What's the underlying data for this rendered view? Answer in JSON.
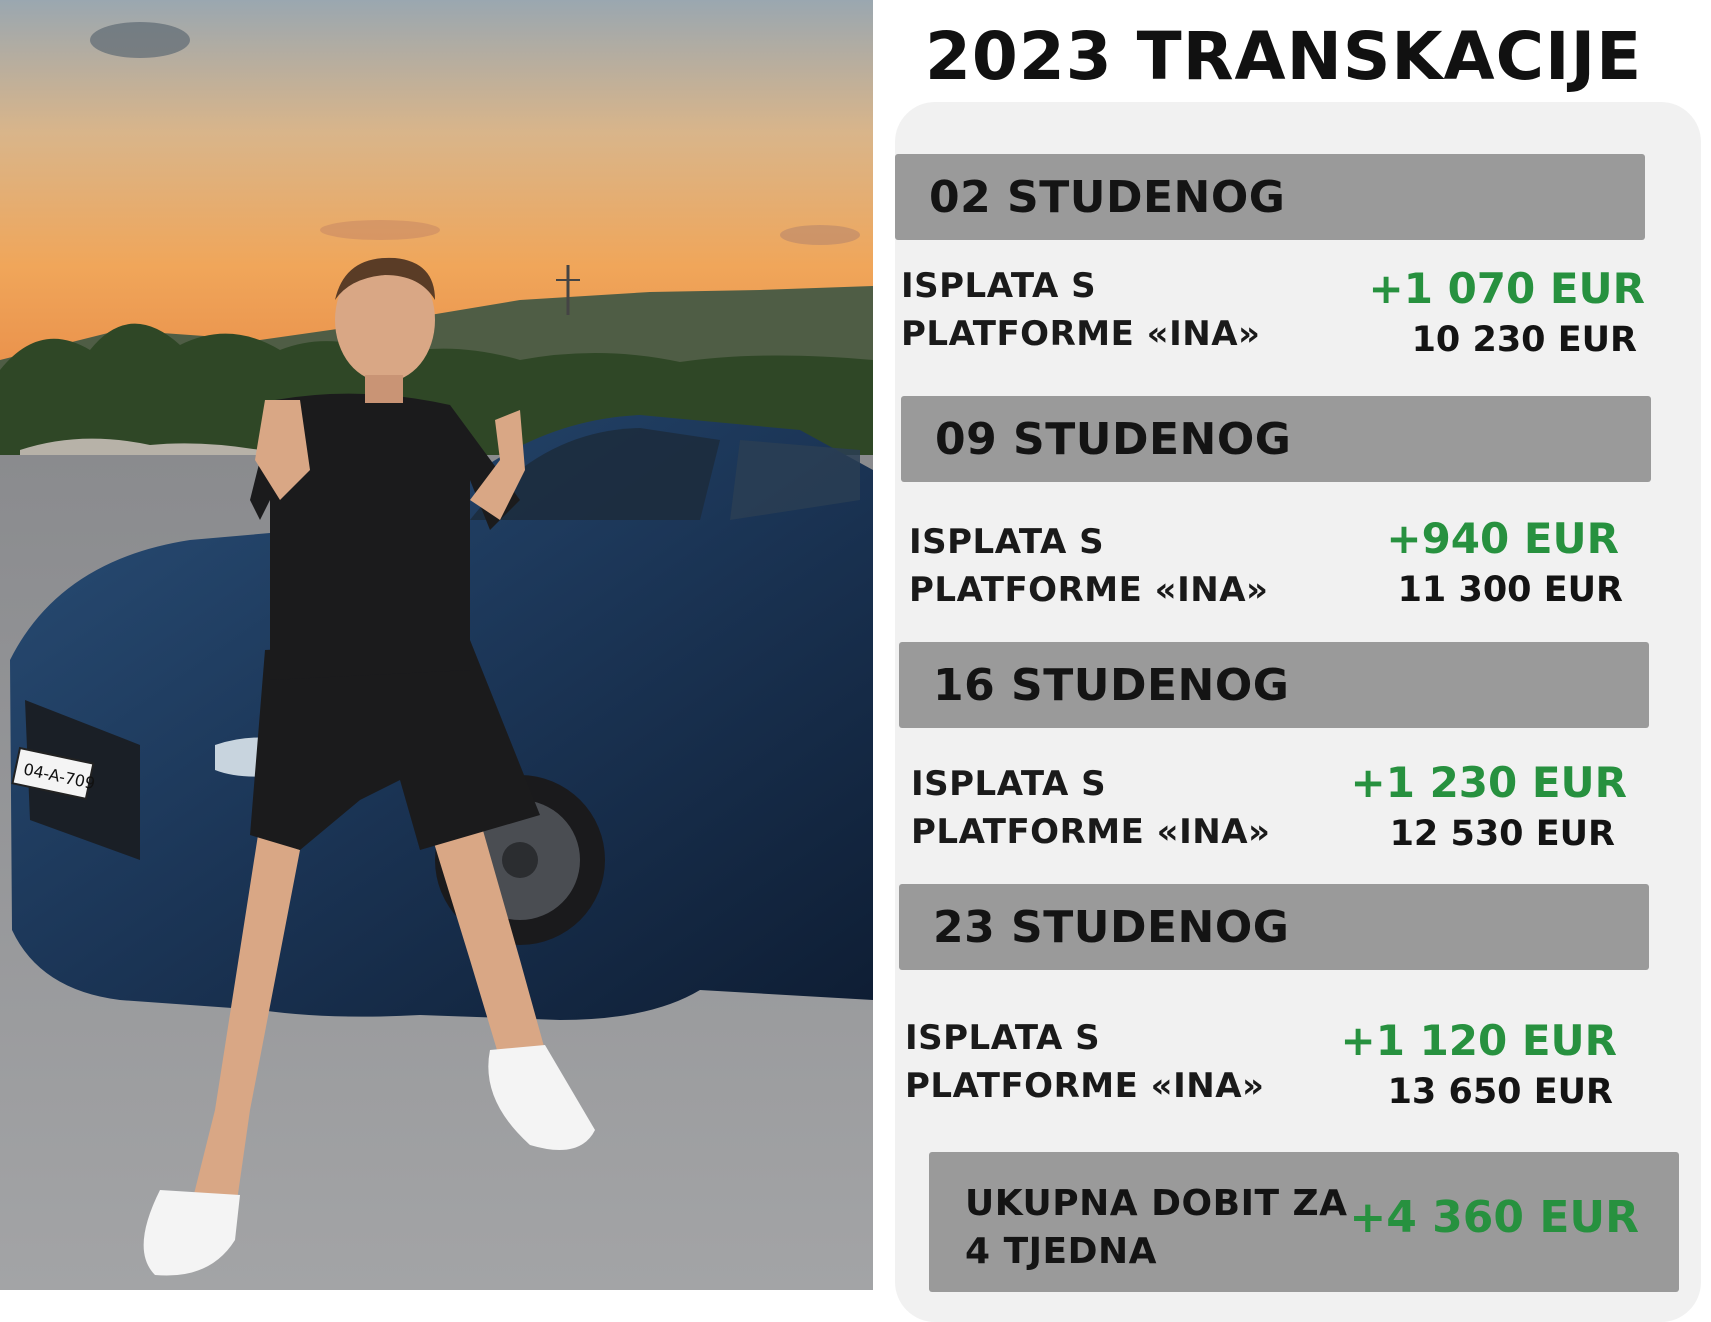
{
  "photo": {
    "description_icon": "person-with-car-photo",
    "plate_text": "04-A-709"
  },
  "title": "2023 TRANSKACIJE",
  "entries": [
    {
      "date": "02 STUDENOG",
      "label_line1": "ISPLATA S",
      "label_line2": "PLATFORME «INA»",
      "amount": "+1 070 EUR",
      "balance": "10 230 EUR"
    },
    {
      "date": "09 STUDENOG",
      "label_line1": "ISPLATA S",
      "label_line2": "PLATFORME «INA»",
      "amount": "+940 EUR",
      "balance": "11 300 EUR"
    },
    {
      "date": "16 STUDENOG",
      "label_line1": "ISPLATA S",
      "label_line2": "PLATFORME «INA»",
      "amount": "+1 230 EUR",
      "balance": "12 530 EUR"
    },
    {
      "date": "23 STUDENOG",
      "label_line1": "ISPLATA S",
      "label_line2": "PLATFORME «INA»",
      "amount": "+1 120 EUR",
      "balance": "13 650 EUR"
    }
  ],
  "total": {
    "label_line1": "UKUPNA DOBIT ZA",
    "label_line2": "4 TJEDNA",
    "amount": "+4 360 EUR"
  },
  "colors": {
    "positive": "#27913f",
    "date_bar": "#9a9a9a",
    "card": "#f1f1f1"
  }
}
